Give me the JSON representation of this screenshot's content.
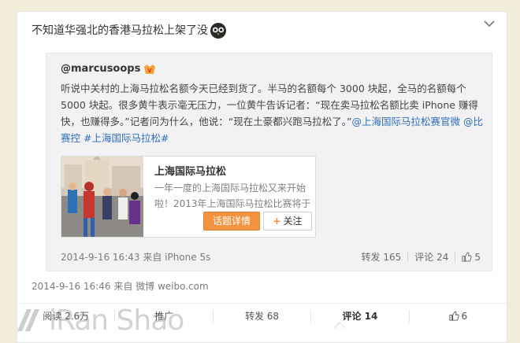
{
  "post": {
    "text": "不知道华强北的香港马拉松上架了没",
    "meta": "2014-9-16 16:46 来自 微博 weibo.com"
  },
  "repost": {
    "author": "@marcusoops",
    "body_text": "听说中关村的上海马拉松名额今天已经到货了。半马的名额每个 3000 块起，全马的名额每个 5000 块起。很多黄牛表示毫无压力，一位黄牛告诉记者：“现在卖马拉松名额比卖 iPhone 赚得快，也赚得多。”记者问为什么，他说：“现在土豪都兴跑马拉松了。”",
    "mention_1": "@上海国际马拉松赛官微",
    "mention_2": "@比赛控",
    "hashtag": "#上海国际马拉松#",
    "meta": "2014-9-16 16:43 来自 iPhone 5s",
    "repost_count_label": "转发 165",
    "comment_count_label": "评论 24",
    "like_count": "5"
  },
  "topic_card": {
    "title": "上海国际马拉松",
    "description": "一年一度的上海国际马拉松又来开始啦！2013年上海国际马拉松比赛将于",
    "detail_button": "话题详情",
    "follow_plus": "+",
    "follow_label": "关注"
  },
  "bottom_bar": {
    "read": "阅读 2.6万",
    "promote": "推广",
    "repost": "转发 68",
    "comment": "评论 14",
    "like": "6"
  },
  "watermark": {
    "text": "iRan Shao"
  },
  "icons": {
    "owl": "owl-emoji-icon",
    "vip": "vip-badge-icon",
    "thumb": "thumbs-up-icon",
    "chevron": "chevron-down-icon"
  },
  "colors": {
    "background": "#f1edd9",
    "link": "#2f6fb6",
    "detail_button": "#f39340",
    "repost_bg": "#f2f2f5"
  }
}
